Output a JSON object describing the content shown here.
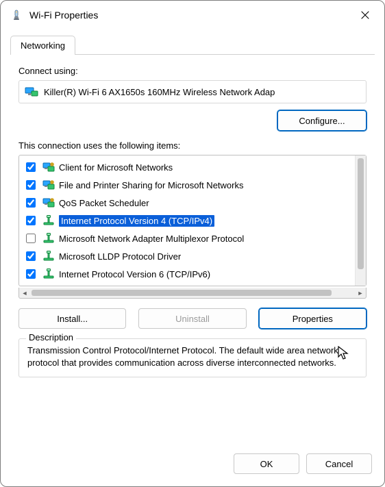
{
  "window": {
    "title": "Wi-Fi Properties"
  },
  "tabs": {
    "networking": "Networking"
  },
  "connect": {
    "label": "Connect using:",
    "adapter": "Killer(R) Wi-Fi 6 AX1650s 160MHz Wireless Network Adap",
    "configure": "Configure..."
  },
  "items": {
    "label": "This connection uses the following items:",
    "rows": [
      {
        "checked": true,
        "icon": "client",
        "label": "Client for Microsoft Networks"
      },
      {
        "checked": true,
        "icon": "service",
        "label": "File and Printer Sharing for Microsoft Networks"
      },
      {
        "checked": true,
        "icon": "service",
        "label": "QoS Packet Scheduler"
      },
      {
        "checked": true,
        "icon": "proto",
        "label": "Internet Protocol Version 4 (TCP/IPv4)",
        "selected": true
      },
      {
        "checked": false,
        "icon": "proto",
        "label": "Microsoft Network Adapter Multiplexor Protocol"
      },
      {
        "checked": true,
        "icon": "proto",
        "label": "Microsoft LLDP Protocol Driver"
      },
      {
        "checked": true,
        "icon": "proto",
        "label": "Internet Protocol Version 6 (TCP/IPv6)"
      }
    ]
  },
  "buttons": {
    "install": "Install...",
    "uninstall": "Uninstall",
    "properties": "Properties",
    "ok": "OK",
    "cancel": "Cancel"
  },
  "description": {
    "legend": "Description",
    "body": "Transmission Control Protocol/Internet Protocol. The default wide area network protocol that provides communication across diverse interconnected networks."
  }
}
